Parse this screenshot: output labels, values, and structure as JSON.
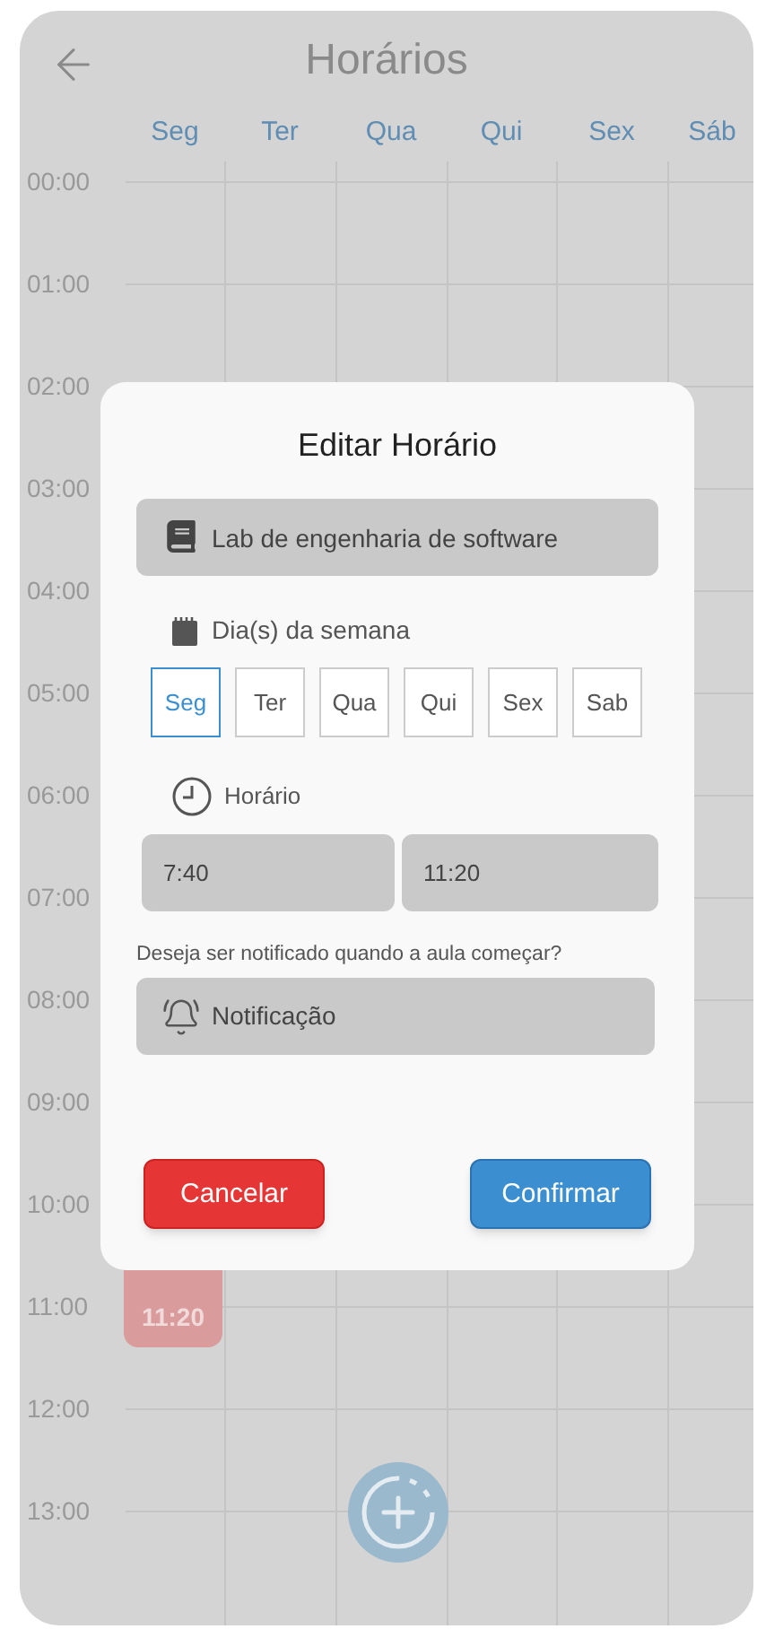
{
  "header": {
    "title": "Horários"
  },
  "schedule": {
    "days": [
      "Seg",
      "Ter",
      "Qua",
      "Qui",
      "Sex",
      "Sáb"
    ],
    "hours": [
      "00:00",
      "01:00",
      "02:00",
      "03:00",
      "04:00",
      "05:00",
      "06:00",
      "07:00",
      "08:00",
      "09:00",
      "10:00",
      "11:00",
      "12:00",
      "13:00"
    ],
    "events": [
      {
        "label": "11:20"
      }
    ]
  },
  "dialog": {
    "title": "Editar Horário",
    "subject": {
      "value": "Lab de engenharia de software"
    },
    "days_label": "Dia(s) da semana",
    "days": [
      {
        "label": "Seg",
        "selected": true
      },
      {
        "label": "Ter",
        "selected": false
      },
      {
        "label": "Qua",
        "selected": false
      },
      {
        "label": "Qui",
        "selected": false
      },
      {
        "label": "Sex",
        "selected": false
      },
      {
        "label": "Sab",
        "selected": false
      }
    ],
    "time_label": "Horário",
    "start_time": {
      "value": "7:40"
    },
    "end_time": {
      "value": "11:20"
    },
    "notify_question": "Deseja ser notificado quando a aula começar?",
    "notification": {
      "label": "Notificação"
    },
    "buttons": [
      {
        "label": "Cancelar",
        "kind": "cancel"
      },
      {
        "label": "Confirmar",
        "kind": "confirm"
      }
    ]
  }
}
